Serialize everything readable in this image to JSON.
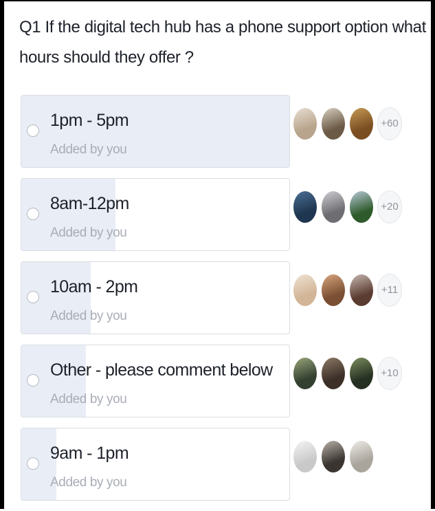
{
  "poll": {
    "question": "Q1 If the digital tech hub has a phone support option what hours should they offer ?",
    "options": [
      {
        "label": "1pm - 5pm",
        "sub": "Added by you",
        "vote_share": 1.0,
        "more": "+60",
        "avatar_colors": [
          [
            "#b8a48c",
            "#e7dfd2"
          ],
          [
            "#6b5a45",
            "#d8cfc2"
          ],
          [
            "#7a4e21",
            "#c69a55"
          ]
        ]
      },
      {
        "label": "8am-12pm",
        "sub": "Added by you",
        "vote_share": 0.35,
        "more": "+20",
        "avatar_colors": [
          [
            "#1f3650",
            "#4b6f95"
          ],
          [
            "#6e6e72",
            "#cfcfd4"
          ],
          [
            "#2f5a2c",
            "#b7c9d6"
          ]
        ]
      },
      {
        "label": "10am - 2pm",
        "sub": "Added by you",
        "vote_share": 0.26,
        "more": "+11",
        "avatar_colors": [
          [
            "#d2b497",
            "#f0e3d3"
          ],
          [
            "#7a4f33",
            "#d9a67d"
          ],
          [
            "#5b3c31",
            "#c6b8b1"
          ]
        ]
      },
      {
        "label": "Other - please comment below",
        "sub": "Added by you",
        "vote_share": 0.24,
        "more": "+10",
        "avatar_colors": [
          [
            "#34402f",
            "#9aa77c"
          ],
          [
            "#3b2f28",
            "#8e7a66"
          ],
          [
            "#263022",
            "#7d8f5f"
          ]
        ]
      },
      {
        "label": "9am - 1pm",
        "sub": "Added by you",
        "vote_share": 0.13,
        "more": "",
        "avatar_colors": [
          [
            "#c9c9c9",
            "#f4f4f4"
          ],
          [
            "#3a3531",
            "#b9b2a8"
          ],
          [
            "#a9a49c",
            "#efece8"
          ]
        ]
      }
    ]
  }
}
